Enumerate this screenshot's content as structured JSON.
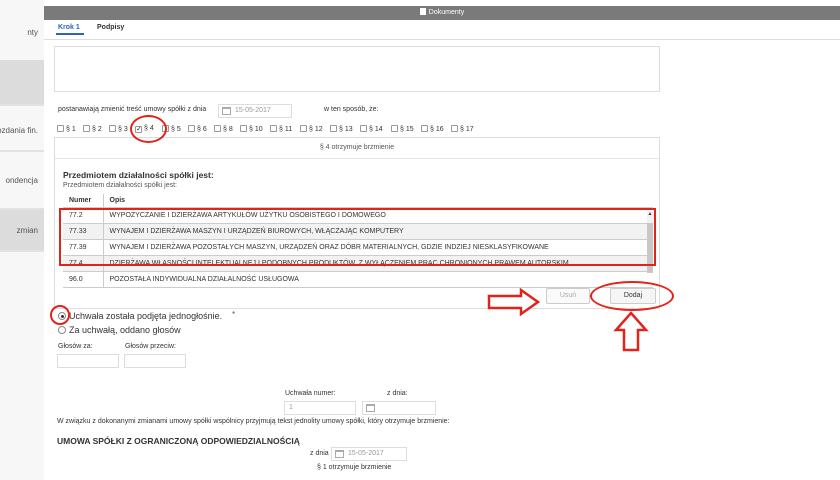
{
  "sidebar": {
    "items": [
      {
        "label": "nty"
      },
      {
        "label": ""
      },
      {
        "label": "ozdania fin."
      },
      {
        "label": "ondencja"
      },
      {
        "label": "zmian"
      }
    ]
  },
  "window": {
    "title": "Dokumenty"
  },
  "tabs": [
    "Krok 1",
    "Podpisy"
  ],
  "resolution": {
    "prefix": "postanawiają zmienić treść umowy spółki z dnia",
    "date": "15-05-2017",
    "suffix": "w ten sposób, że:"
  },
  "paragraphs": [
    {
      "label": "§ 1",
      "checked": false
    },
    {
      "label": "§ 2",
      "checked": false
    },
    {
      "label": "§ 3",
      "checked": false
    },
    {
      "label": "§ 4",
      "checked": true
    },
    {
      "label": "§ 5",
      "checked": false
    },
    {
      "label": "§ 6",
      "checked": false
    },
    {
      "label": "§ 8",
      "checked": false
    },
    {
      "label": "§ 10",
      "checked": false
    },
    {
      "label": "§ 11",
      "checked": false
    },
    {
      "label": "§ 12",
      "checked": false
    },
    {
      "label": "§ 13",
      "checked": false
    },
    {
      "label": "§ 14",
      "checked": false
    },
    {
      "label": "§ 15",
      "checked": false
    },
    {
      "label": "§ 16",
      "checked": false
    },
    {
      "label": "§ 17",
      "checked": false
    }
  ],
  "panel": {
    "caption": "§ 4 otrzymuje brzmienie",
    "heading": "Przedmiotem działalności spółki jest:",
    "sublabel": "Przedmiotem działalności spółki jest:",
    "columns": [
      "Numer",
      "Opis"
    ],
    "rows": [
      {
        "num": "77.2",
        "desc": "WYPOŻYCZANIE I DZIERŻAWA ARTYKUŁÓW UŻYTKU OSOBISTEGO I DOMOWEGO"
      },
      {
        "num": "77.33",
        "desc": "WYNAJEM I DZIERŻAWA MASZYN I URZĄDZEŃ BIUROWYCH, WŁĄCZAJĄC KOMPUTERY"
      },
      {
        "num": "77.39",
        "desc": "WYNAJEM I DZIERŻAWA POZOSTAŁYCH MASZYN, URZĄDZEŃ ORAZ DÓBR MATERIALNYCH, GDZIE INDZIEJ NIESKLASYFIKOWANE"
      },
      {
        "num": "77.4",
        "desc": "DZIERŻAWA WŁASNOŚCI INTELEKTUALNEJ I PODOBNYCH PRODUKTÓW, Z WYŁĄCZENIEM PRAC CHRONIONYCH PRAWEM AUTORSKIM"
      },
      {
        "num": "96.0",
        "desc": "POZOSTAŁA INDYWIDUALNA DZIAŁALNOŚĆ USŁUGOWA"
      }
    ],
    "btn_remove": "Usuń",
    "btn_add": "Dodaj"
  },
  "vote": {
    "option1": "Uchwała została podjęta jednogłośnie.",
    "option2": "Za uchwałą, oddano głosów",
    "required_mark": "*",
    "votes_for_label": "Głosów za:",
    "votes_against_label": "Głosów przeciw:"
  },
  "resolution_number": {
    "label": "Uchwała numer:",
    "value": "1",
    "date_label": "z dnia:"
  },
  "note": "W związku z dokonanymi zmianami umowy spółki wspólnicy przyjmują tekst jednolity umowy spółki, który otrzymuje brzmienie:",
  "contract": {
    "title": "UMOWA SPÓŁKI Z OGRANICZONĄ ODPOWIEDZIALNOŚCIĄ",
    "date_label": "z dnia",
    "date": "15-05-2017",
    "caption": "§ 1 otrzymuje brzmienie"
  },
  "annotation_color": "#e2231a",
  "accent_color": "#2a63b8"
}
